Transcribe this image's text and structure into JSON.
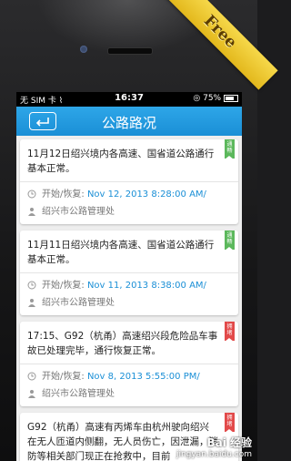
{
  "ribbon": {
    "label": "Free"
  },
  "status": {
    "carrier": "无 SIM 卡",
    "time": "16:37",
    "battery": "75%"
  },
  "nav": {
    "title": "公路路况"
  },
  "cards": [
    {
      "text": "11月12日绍兴境内各高速、国省道公路通行基本正常。",
      "tag": "通畅",
      "tag_color": "green",
      "start_label": "开始/恢复:",
      "start_value": "Nov 12, 2013 8:28:00 AM/",
      "org": "绍兴市公路管理处"
    },
    {
      "text": "11月11日绍兴境内各高速、国省道公路通行基本正常。",
      "tag": "通畅",
      "tag_color": "green",
      "start_label": "开始/恢复:",
      "start_value": "Nov 11, 2013 8:38:00 AM/",
      "org": "绍兴市公路管理处"
    },
    {
      "text": "17:15、G92（杭甬）高速绍兴段危险品车事故已处理完毕，通行恢复正常。",
      "tag": "拥堵",
      "tag_color": "red",
      "start_label": "开始/恢复:",
      "start_value": "Nov 8, 2013 5:55:00 PM/",
      "org": "绍兴市公路管理处"
    },
    {
      "text": "G92（杭甬）高速有丙烯车由杭州驶向绍兴在无人匝道内侧翻，无人员伤亡，因泄漏，消防等相关部门现正在抢救中，目前",
      "tag": "拥堵",
      "tag_color": "red"
    }
  ],
  "watermark": {
    "brand": "Bai 经验",
    "url": "jingyan.baidu.com"
  },
  "colors": {
    "navbar": "#1a8fd6",
    "accent_text": "#1a8fd6",
    "tag_green": "#5cb85c",
    "tag_red": "#e24a4a",
    "ribbon": "#e3b81c"
  }
}
